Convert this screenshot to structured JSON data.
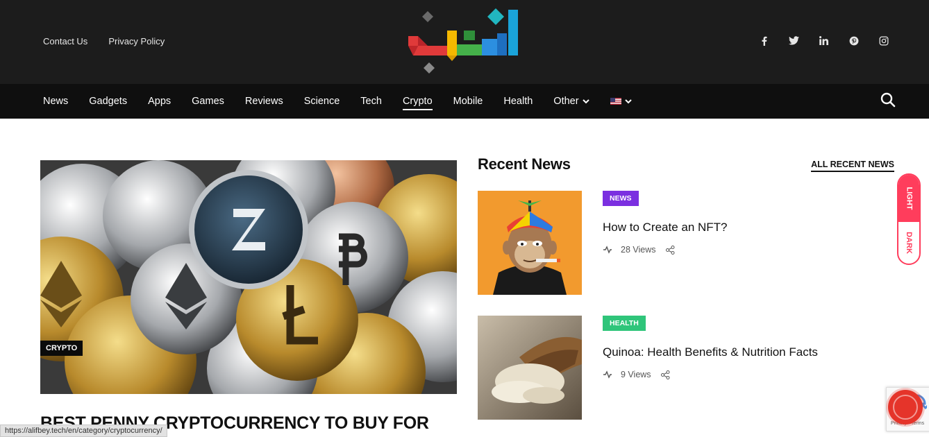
{
  "top_links": [
    "Contact Us",
    "Privacy Policy"
  ],
  "social_icons": [
    "facebook-icon",
    "twitter-icon",
    "linkedin-icon",
    "pinterest-icon",
    "instagram-icon"
  ],
  "nav": {
    "items": [
      "News",
      "Gadgets",
      "Apps",
      "Games",
      "Reviews",
      "Science",
      "Tech",
      "Crypto",
      "Mobile",
      "Health"
    ],
    "active": "Crypto",
    "other_label": "Other"
  },
  "featured": {
    "category": "CRYPTO",
    "title": "BEST PENNY CRYPTOCURRENCY TO BUY FOR"
  },
  "status_url": "https://alifbey.tech/en/category/cryptocurrency/",
  "recent": {
    "heading": "Recent News",
    "all_link": "ALL RECENT NEWS",
    "cards": [
      {
        "badge": "NEWS",
        "badge_color": "#7b2fe0",
        "title": "How to Create an NFT?",
        "views": "28 Views"
      },
      {
        "badge": "HEALTH",
        "badge_color": "#2fc57a",
        "title": "Quinoa: Health Benefits & Nutrition Facts",
        "views": "9 Views"
      }
    ]
  },
  "theme_toggle": {
    "light": "LIGHT",
    "dark": "DARK"
  },
  "recaptcha_text": "Privacy - Terms",
  "colors": {
    "topbar": "#1c1c1c",
    "navbar": "#0f0f0f",
    "accent": "#ff3d5c"
  }
}
